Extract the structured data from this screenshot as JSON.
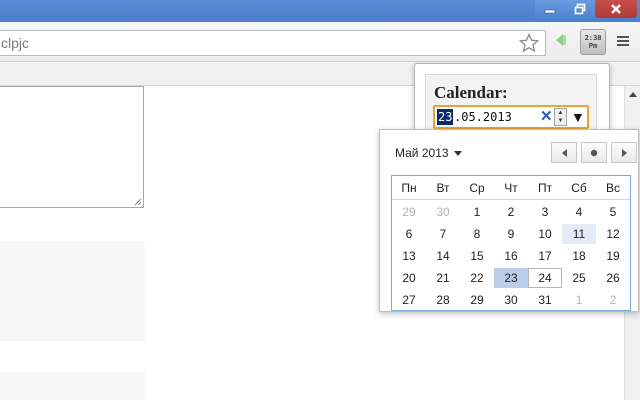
{
  "window": {
    "minimize_icon": "minimize-icon",
    "restore_icon": "restore-icon",
    "close_icon": "close-icon"
  },
  "toolbar": {
    "address_text": "clpjc",
    "star_icon": "star-icon",
    "extension_icon": "green-arrow-icon",
    "clock_line1": "2:38",
    "clock_line2": "Pm",
    "menu_icon": "hamburger-menu-icon"
  },
  "popup": {
    "label": "Calendar:",
    "date_day": "23",
    "date_rest": ".05.2013",
    "clear_glyph": "✕",
    "dropdown_glyph": "▼",
    "accent_color": "#e8a33a"
  },
  "picker": {
    "month_label": "Май 2013",
    "weekdays": [
      "Пн",
      "Вт",
      "Ср",
      "Чт",
      "Пт",
      "Сб",
      "Вс"
    ],
    "weeks": [
      [
        {
          "d": "29",
          "dim": true
        },
        {
          "d": "30",
          "dim": true
        },
        {
          "d": "1"
        },
        {
          "d": "2"
        },
        {
          "d": "3"
        },
        {
          "d": "4"
        },
        {
          "d": "5"
        }
      ],
      [
        {
          "d": "6"
        },
        {
          "d": "7"
        },
        {
          "d": "8"
        },
        {
          "d": "9"
        },
        {
          "d": "10"
        },
        {
          "d": "11",
          "hl": true
        },
        {
          "d": "12"
        }
      ],
      [
        {
          "d": "13"
        },
        {
          "d": "14"
        },
        {
          "d": "15"
        },
        {
          "d": "16"
        },
        {
          "d": "17"
        },
        {
          "d": "18"
        },
        {
          "d": "19"
        }
      ],
      [
        {
          "d": "20"
        },
        {
          "d": "21"
        },
        {
          "d": "22"
        },
        {
          "d": "23",
          "sel": true
        },
        {
          "d": "24",
          "today": true
        },
        {
          "d": "25"
        },
        {
          "d": "26"
        }
      ],
      [
        {
          "d": "27"
        },
        {
          "d": "28"
        },
        {
          "d": "29"
        },
        {
          "d": "30"
        },
        {
          "d": "31"
        },
        {
          "d": "1",
          "dim": true
        },
        {
          "d": "2",
          "dim": true
        }
      ]
    ],
    "selected_color": "#bccde9",
    "highlight_color": "#e4ebf7"
  }
}
